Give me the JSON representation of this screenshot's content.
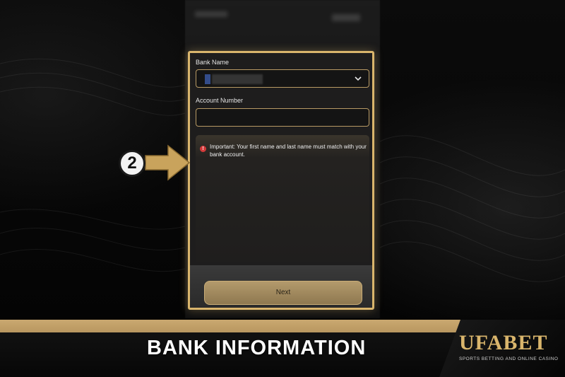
{
  "form": {
    "bank_name_label": "Bank Name",
    "account_number_label": "Account Number",
    "account_number_value": "",
    "notice_icon": "!",
    "notice_text": "Important: Your first name and last name must match with your bank account.",
    "next_label": "Next"
  },
  "step": {
    "number": "2"
  },
  "banner": {
    "title": "BANK INFORMATION",
    "brand": "UFABET",
    "tagline": "SPORTS BETTING AND ONLINE CASINO"
  },
  "colors": {
    "accent": "#d9b56c",
    "button": "#b39a6c",
    "error": "#d43a3a"
  },
  "icons": [
    "chevron-down-icon",
    "warning-icon",
    "arrow-right-icon"
  ]
}
